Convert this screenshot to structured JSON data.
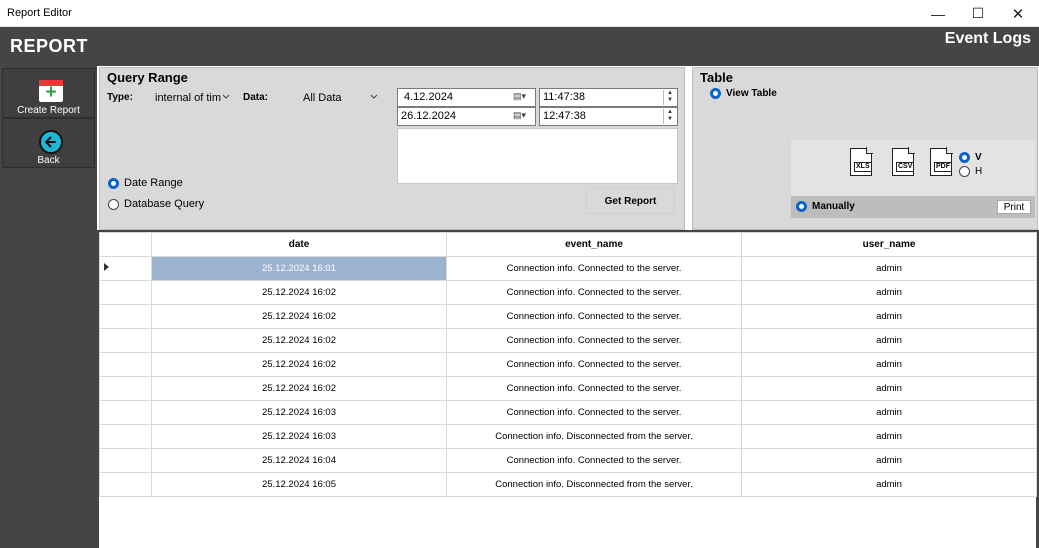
{
  "window": {
    "title": "Report Editor",
    "minimize": "—",
    "maximize": "☐",
    "close": "✕"
  },
  "header": {
    "app_title": "REPORT",
    "page_title": "Event Logs"
  },
  "sidebar": {
    "items": [
      {
        "label": "Create Report",
        "icon": "calendar-plus-icon"
      },
      {
        "label": "Back",
        "icon": "back-arrow-icon"
      }
    ]
  },
  "query": {
    "title": "Query Range",
    "type_label": "Type:",
    "type_value": "internal of tim",
    "data_label": "Data:",
    "data_value": "All Data",
    "start_date": "4.12.2024",
    "end_date": "26.12.2024",
    "start_time": "11:47:38",
    "end_time": "12:47:38",
    "radio_date_range": "Date Range",
    "radio_database_query": "Database Query",
    "get_report": "Get Report"
  },
  "table_panel": {
    "title": "Table",
    "view_table": "View Table",
    "exports": [
      "XLS",
      "CSV",
      "PDF"
    ],
    "orient_v": "V",
    "orient_h": "H",
    "manually": "Manually",
    "print": "Print"
  },
  "grid": {
    "columns": [
      "date",
      "event_name",
      "user_name"
    ],
    "rows": [
      [
        "25.12.2024 16:01",
        "Connection info. Connected to the server.",
        "admin"
      ],
      [
        "25.12.2024 16:02",
        "Connection info. Connected to the server.",
        "admin"
      ],
      [
        "25.12.2024 16:02",
        "Connection info. Connected to the server.",
        "admin"
      ],
      [
        "25.12.2024 16:02",
        "Connection info. Connected to the server.",
        "admin"
      ],
      [
        "25.12.2024 16:02",
        "Connection info. Connected to the server.",
        "admin"
      ],
      [
        "25.12.2024 16:02",
        "Connection info. Connected to the server.",
        "admin"
      ],
      [
        "25.12.2024 16:03",
        "Connection info. Connected to the server.",
        "admin"
      ],
      [
        "25.12.2024 16:03",
        "Connection info. Disconnected from the server.",
        "admin"
      ],
      [
        "25.12.2024 16:04",
        "Connection info. Connected to the server.",
        "admin"
      ],
      [
        "25.12.2024 16:05",
        "Connection info. Disconnected from the server.",
        "admin"
      ]
    ],
    "selected_row": 0
  }
}
